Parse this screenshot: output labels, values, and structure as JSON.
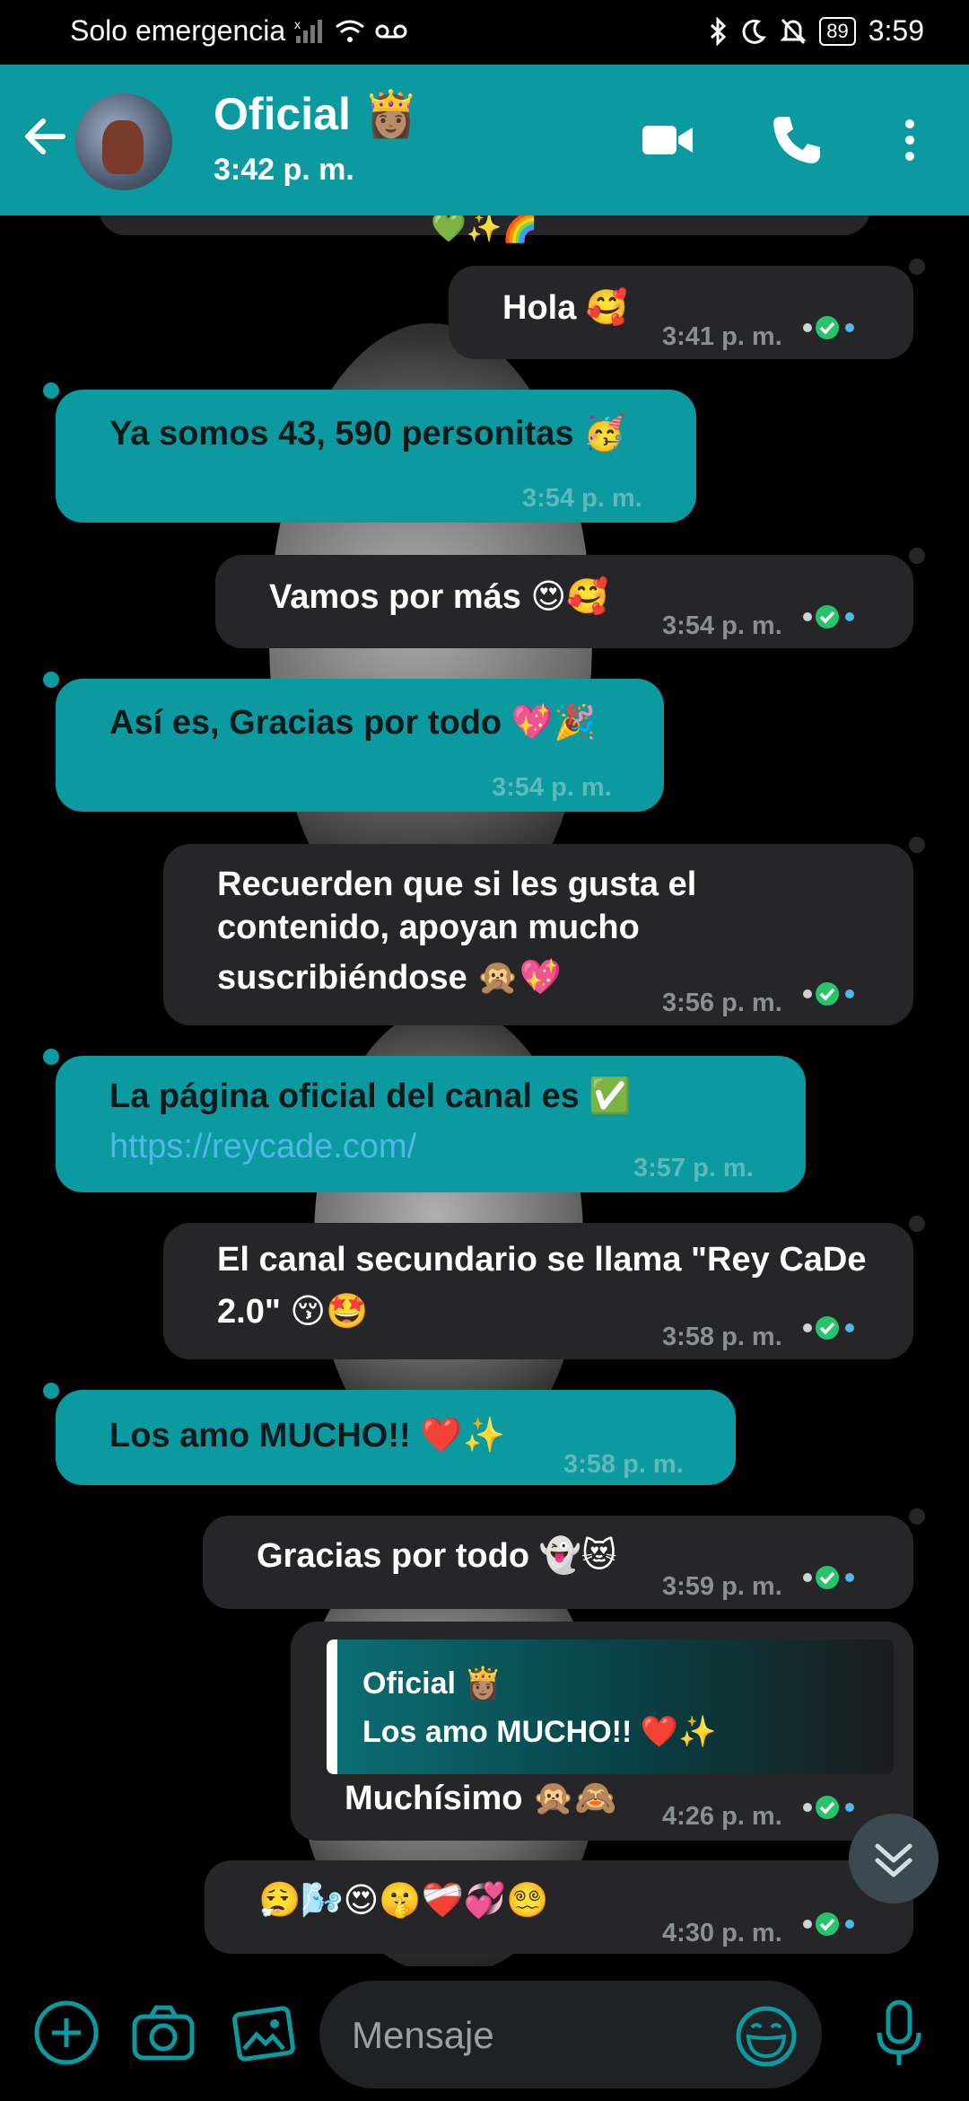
{
  "status_bar": {
    "carrier": "Solo emergencia",
    "battery": "89",
    "time": "3:59"
  },
  "header": {
    "contact_name": "Oficial 👸🏽",
    "last_seen": "3:42 p. m."
  },
  "messages": [
    {
      "dir": "out",
      "text": "💚✨🌈",
      "time": ""
    },
    {
      "dir": "out",
      "text": "Hola 🥰",
      "time": "3:41 p. m."
    },
    {
      "dir": "in",
      "text": "Ya somos 43, 590 personitas 🥳",
      "time": "3:54 p. m."
    },
    {
      "dir": "out",
      "text": "Vamos por más 😍🥰",
      "time": "3:54 p. m."
    },
    {
      "dir": "in",
      "text": "Así es, Gracias por todo 💖🎉",
      "time": "3:54 p. m."
    },
    {
      "dir": "out",
      "line1": "Recuerden que si les gusta el",
      "line2": "contenido, apoyan mucho",
      "line3": "suscribiéndose 🙊💖",
      "time": "3:56 p. m."
    },
    {
      "dir": "in",
      "text": "La página oficial del canal es ✅",
      "link": "https://reycade.com/",
      "time": "3:57 p. m."
    },
    {
      "dir": "out",
      "line1": "El canal secundario se llama \"Rey CaDe",
      "line2": "2.0\" 😚🤩",
      "time": "3:58 p. m."
    },
    {
      "dir": "in",
      "text": "Los amo MUCHO!! ❤️✨",
      "time": "3:58 p. m."
    },
    {
      "dir": "out",
      "text": "Gracias por todo 👻😻",
      "time": "3:59 p. m."
    },
    {
      "dir": "out",
      "reply_name": "Oficial 👸🏽",
      "reply_text": "Los amo MUCHO!! ❤️✨",
      "text": "Muchísimo 🙊🙈",
      "time": "4:26 p. m."
    },
    {
      "dir": "out",
      "text": "😮‍💨🌬️😍🤫❤️‍🩹💞😵‍💫",
      "time": "4:30 p. m."
    }
  ],
  "input": {
    "placeholder": "Mensaje"
  },
  "colors": {
    "accent": "#0a9aa0",
    "outgoing_bubble": "#262629",
    "incoming_bubble": "#0a9aa0",
    "read_tick": "#27c46b",
    "link": "#4fb8e8"
  }
}
